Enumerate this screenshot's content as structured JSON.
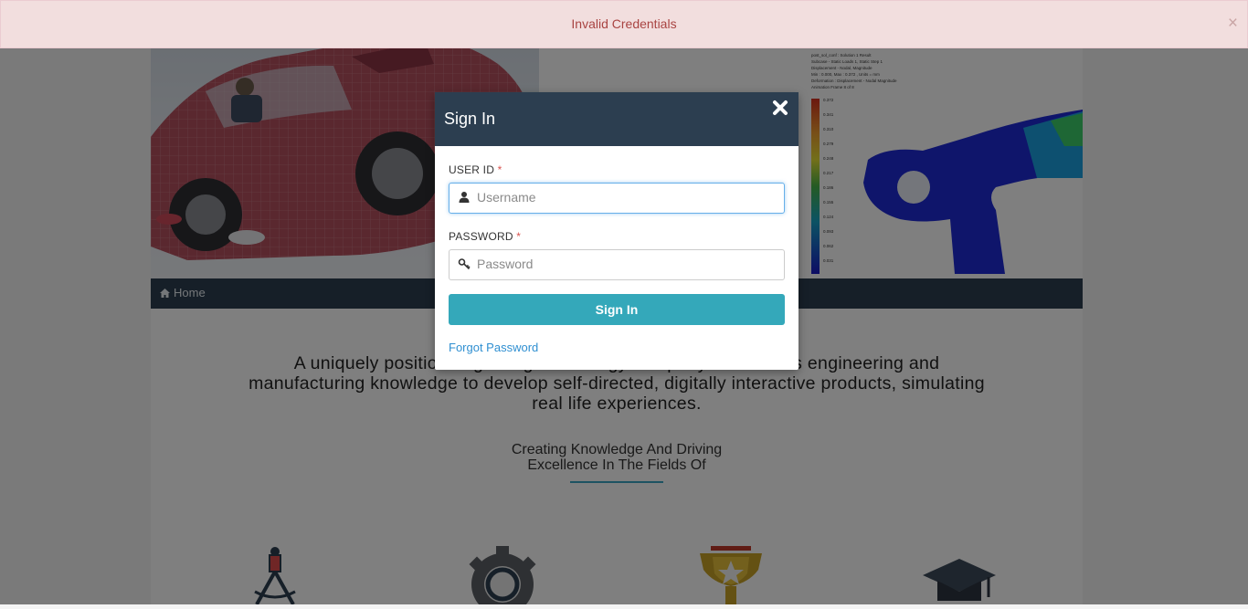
{
  "alert": {
    "message": "Invalid Credentials",
    "close_glyph": "×"
  },
  "nav": {
    "home_label": "Home"
  },
  "hero": {
    "fea_caption_lines": [
      "post_sol_conf : Solution 1 Result",
      "Subcase - Static Loads 1, Static Step 1",
      "Displacement - Nodal, Magnitude",
      "Min : 0.000, Max : 0.372 , Units = mm",
      "Deformation : Displacement - Nodal Magnitude",
      "Animation Frame 8 of 8"
    ],
    "legend_values": [
      "0.372",
      "0.341",
      "0.310",
      "0.279",
      "0.248",
      "0.217",
      "0.186",
      "0.155",
      "0.124",
      "0.093",
      "0.062",
      "0.031"
    ]
  },
  "main": {
    "tagline": "A uniquely positioned gaming technology company that blends engineering and manufacturing knowledge to develop self-directed, digitally interactive products, simulating real life experiences.",
    "subtag_line1": "Creating Knowledge And Driving",
    "subtag_line2": "Excellence In The Fields Of"
  },
  "features": [
    {
      "icon": "compass-icon"
    },
    {
      "icon": "gear-icon"
    },
    {
      "icon": "trophy-icon"
    },
    {
      "icon": "graduation-cap-icon"
    }
  ],
  "modal": {
    "title": "Sign In",
    "user_label": "USER ID",
    "user_placeholder": "Username",
    "password_label": "PASSWORD",
    "password_placeholder": "Password",
    "required_mark": "*",
    "submit_label": "Sign In",
    "forgot_label": "Forgot Password"
  },
  "colors": {
    "header": "#2c3e50",
    "button": "#34a8ba",
    "alert_bg": "#f2dede",
    "alert_text": "#a94442",
    "link": "#2f8fd1"
  }
}
